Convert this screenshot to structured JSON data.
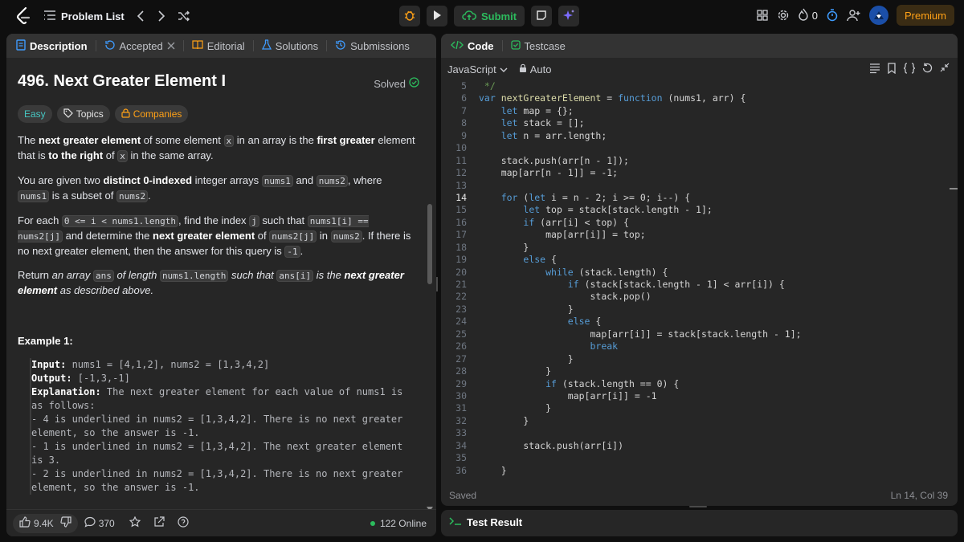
{
  "topbar": {
    "problem_list": "Problem List",
    "submit": "Submit",
    "streak_count": "0",
    "premium": "Premium"
  },
  "left_tabs": [
    {
      "label": "Description"
    },
    {
      "label": "Accepted"
    },
    {
      "label": "Editorial"
    },
    {
      "label": "Solutions"
    },
    {
      "label": "Submissions"
    }
  ],
  "problem": {
    "title": "496. Next Greater Element I",
    "status": "Solved",
    "difficulty": "Easy",
    "topics": "Topics",
    "companies": "Companies"
  },
  "description": {
    "p1_a": "The ",
    "p1_b": "next greater element",
    "p1_c": " of some element ",
    "p1_x": "x",
    "p1_d": " in an array is the ",
    "p1_e": "first greater",
    "p1_f": " element that is ",
    "p1_g": "to the right",
    "p1_h": " of ",
    "p1_i": " in the same array.",
    "p2_a": "You are given two ",
    "p2_b": "distinct 0-indexed",
    "p2_c": " integer arrays ",
    "p2_nums1": "nums1",
    "p2_d": " and ",
    "p2_nums2": "nums2",
    "p2_e": ", where ",
    "p2_f": " is a subset of ",
    "p2_g": ".",
    "p3_a": "For each ",
    "p3_code1": "0 <= i < nums1.length",
    "p3_b": ", find the index ",
    "p3_j": "j",
    "p3_c": " such that ",
    "p3_code2": "nums1[i] == nums2[j]",
    "p3_d": " and determine the ",
    "p3_e": "next greater element",
    "p3_f": " of ",
    "p3_code3": "nums2[j]",
    "p3_g": " in ",
    "p3_code4": "nums2",
    "p3_h": ". If there is no next greater element, then the answer for this query is ",
    "p3_code5": "-1",
    "p3_i": ".",
    "p4_a": "Return ",
    "p4_b": "an array ",
    "p4_ans": "ans",
    "p4_c": " of length ",
    "p4_len": "nums1.length",
    "p4_d": " such that ",
    "p4_ansi": "ans[i]",
    "p4_e": " is the ",
    "p4_f": "next greater element",
    "p4_g": " as described above."
  },
  "example": {
    "title": "Example 1:",
    "input_label": "Input:",
    "input_value": " nums1 = [4,1,2], nums2 = [1,3,4,2]",
    "output_label": "Output:",
    "output_value": " [-1,3,-1]",
    "explanation_label": "Explanation:",
    "explanation_value": " The next greater element for each value of nums1 is as follows:",
    "bullet1": "- 4 is underlined in nums2 = [1,3,4,2]. There is no next greater element, so the answer is -1.",
    "bullet2": "- 1 is underlined in nums2 = [1,3,4,2]. The next greater element is 3.",
    "bullet3": "- 2 is underlined in nums2 = [1,3,4,2]. There is no next greater element, so the answer is -1."
  },
  "footer": {
    "likes": "9.4K",
    "comments": "370",
    "online": "122 Online"
  },
  "editor": {
    "tab_code": "Code",
    "tab_testcase": "Testcase",
    "language": "JavaScript",
    "mode": "Auto",
    "saved": "Saved",
    "cursor": "Ln 14, Col 39",
    "current_line": 14
  },
  "code_lines": [
    {
      "n": "5",
      "t": " */"
    },
    {
      "n": "6",
      "t": "var nextGreaterElement = function (nums1, arr) {"
    },
    {
      "n": "7",
      "t": "    let map = {};"
    },
    {
      "n": "8",
      "t": "    let stack = [];"
    },
    {
      "n": "9",
      "t": "    let n = arr.length;"
    },
    {
      "n": "10",
      "t": ""
    },
    {
      "n": "11",
      "t": "    stack.push(arr[n - 1]);"
    },
    {
      "n": "12",
      "t": "    map[arr[n - 1]] = -1;"
    },
    {
      "n": "13",
      "t": ""
    },
    {
      "n": "14",
      "t": "    for (let i = n - 2; i >= 0; i--) {"
    },
    {
      "n": "15",
      "t": "        let top = stack[stack.length - 1];"
    },
    {
      "n": "16",
      "t": "        if (arr[i] < top) {"
    },
    {
      "n": "17",
      "t": "            map[arr[i]] = top;"
    },
    {
      "n": "18",
      "t": "        }"
    },
    {
      "n": "19",
      "t": "        else {"
    },
    {
      "n": "20",
      "t": "            while (stack.length) {"
    },
    {
      "n": "21",
      "t": "                if (stack[stack.length - 1] < arr[i]) {"
    },
    {
      "n": "22",
      "t": "                    stack.pop()"
    },
    {
      "n": "23",
      "t": "                }"
    },
    {
      "n": "24",
      "t": "                else {"
    },
    {
      "n": "25",
      "t": "                    map[arr[i]] = stack[stack.length - 1];"
    },
    {
      "n": "26",
      "t": "                    break"
    },
    {
      "n": "27",
      "t": "                }"
    },
    {
      "n": "28",
      "t": "            }"
    },
    {
      "n": "29",
      "t": "            if (stack.length == 0) {"
    },
    {
      "n": "30",
      "t": "                map[arr[i]] = -1"
    },
    {
      "n": "31",
      "t": "            }"
    },
    {
      "n": "32",
      "t": "        }"
    },
    {
      "n": "33",
      "t": ""
    },
    {
      "n": "34",
      "t": "        stack.push(arr[i])"
    },
    {
      "n": "35",
      "t": ""
    },
    {
      "n": "36",
      "t": "    }"
    }
  ],
  "bottom": {
    "test_result": "Test Result"
  },
  "colors": {
    "accent_green": "#2cbb5d",
    "premium_orange": "#ffa116",
    "easy_teal": "#46c6c2",
    "keyword_blue": "#569cd6"
  }
}
